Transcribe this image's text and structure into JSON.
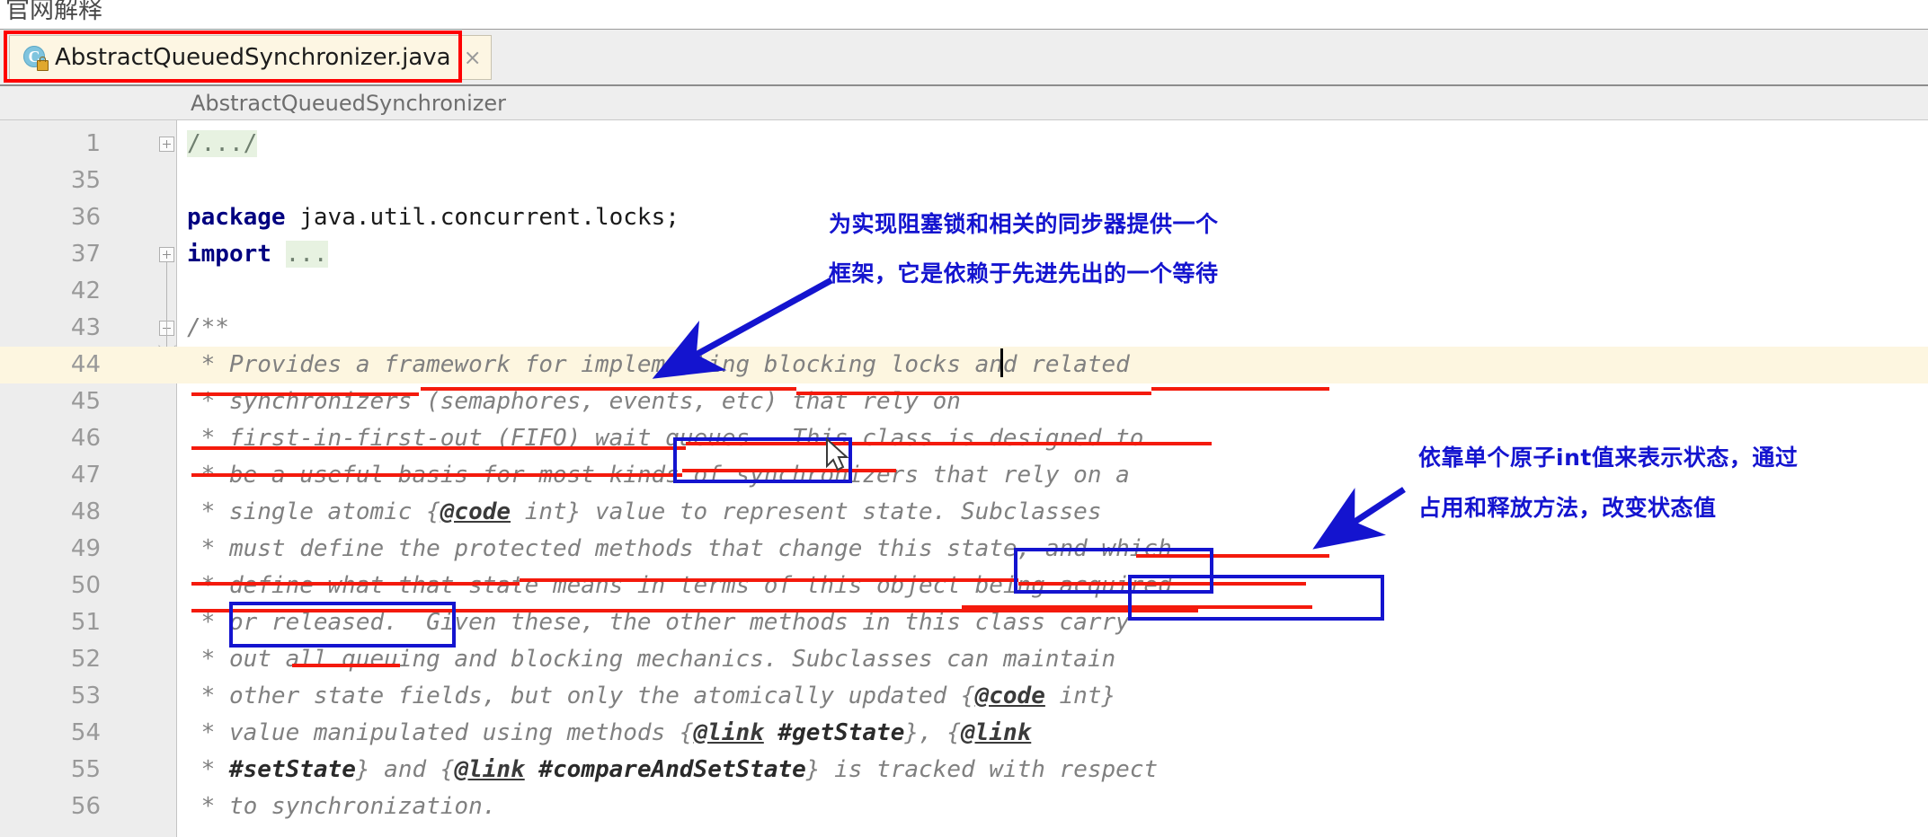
{
  "page": {
    "heading": "官网解释"
  },
  "tab": {
    "label": "AbstractQueuedSynchronizer.java",
    "close": "×",
    "icon_letter": "C",
    "icon_name": "java-class-locked-icon",
    "highlight_color": "#ff0000"
  },
  "breadcrumb": {
    "text": "AbstractQueuedSynchronizer"
  },
  "editor": {
    "current_line": 44,
    "lines": [
      {
        "no": "1",
        "segments": [
          {
            "t": "/.../",
            "c": "fold-ph"
          }
        ],
        "fold": "plus"
      },
      {
        "no": "35",
        "segments": [
          {
            "t": "",
            "c": "plain"
          }
        ]
      },
      {
        "no": "36",
        "segments": [
          {
            "t": "package ",
            "c": "kw"
          },
          {
            "t": "java.util.concurrent.locks;",
            "c": "plain"
          }
        ]
      },
      {
        "no": "37",
        "segments": [
          {
            "t": "import ",
            "c": "kw"
          },
          {
            "t": "...",
            "c": "fold-ph"
          }
        ],
        "fold": "plus"
      },
      {
        "no": "42",
        "segments": [
          {
            "t": "",
            "c": "plain"
          }
        ]
      },
      {
        "no": "43",
        "segments": [
          {
            "t": "/**",
            "c": "jdoc"
          }
        ],
        "fold": "minus"
      },
      {
        "no": "44",
        "segments": [
          {
            "t": " * Provides a framework for implementing blocking locks and related",
            "c": "jdoc"
          }
        ]
      },
      {
        "no": "45",
        "segments": [
          {
            "t": " * synchronizers (semaphores, events, etc) that rely on",
            "c": "jdoc"
          }
        ]
      },
      {
        "no": "46",
        "segments": [
          {
            "t": " * first-in-first-out (FIFO) wait queues.  This class is designed to",
            "c": "jdoc"
          }
        ]
      },
      {
        "no": "47",
        "segments": [
          {
            "t": " * be a useful basis for most kinds of synchronizers that rely on a",
            "c": "jdoc"
          }
        ]
      },
      {
        "no": "48",
        "segments": [
          {
            "t": " * single atomic {",
            "c": "jdoc"
          },
          {
            "t": "@code",
            "c": "tag"
          },
          {
            "t": " int} value to represent state. Subclasses",
            "c": "jdoc"
          }
        ]
      },
      {
        "no": "49",
        "segments": [
          {
            "t": " * must define the protected methods that change this state, and which",
            "c": "jdoc"
          }
        ]
      },
      {
        "no": "50",
        "segments": [
          {
            "t": " * define what that state means in terms of this object being acquired",
            "c": "jdoc"
          }
        ]
      },
      {
        "no": "51",
        "segments": [
          {
            "t": " * or released.  Given these, the other methods in this class carry",
            "c": "jdoc"
          }
        ]
      },
      {
        "no": "52",
        "segments": [
          {
            "t": " * out all queuing and blocking mechanics. Subclasses can maintain",
            "c": "jdoc"
          }
        ]
      },
      {
        "no": "53",
        "segments": [
          {
            "t": " * other state fields, but only the atomically updated {",
            "c": "jdoc"
          },
          {
            "t": "@code",
            "c": "tag"
          },
          {
            "t": " int}",
            "c": "jdoc"
          }
        ]
      },
      {
        "no": "54",
        "segments": [
          {
            "t": " * value manipulated using methods {",
            "c": "jdoc"
          },
          {
            "t": "@link",
            "c": "tag"
          },
          {
            "t": " ",
            "c": "jdoc"
          },
          {
            "t": "#getState",
            "c": "taglink"
          },
          {
            "t": "}, {",
            "c": "jdoc"
          },
          {
            "t": "@link",
            "c": "tag"
          }
        ]
      },
      {
        "no": "55",
        "segments": [
          {
            "t": " * ",
            "c": "jdoc"
          },
          {
            "t": "#setState",
            "c": "taglink"
          },
          {
            "t": "} and {",
            "c": "jdoc"
          },
          {
            "t": "@link",
            "c": "tag"
          },
          {
            "t": " ",
            "c": "jdoc"
          },
          {
            "t": "#compareAndSetState",
            "c": "taglink"
          },
          {
            "t": "} is tracked with respect",
            "c": "jdoc"
          }
        ]
      },
      {
        "no": "56",
        "segments": [
          {
            "t": " * to synchronization.",
            "c": "jdoc"
          }
        ]
      }
    ]
  },
  "annotations": {
    "color": "#1414cf",
    "underline_color": "#f41a0c",
    "note1": {
      "line1": "为实现阻塞锁和相关的同步器提供一个",
      "line2": "框架，它是依赖于先进先出的一个等待"
    },
    "note2": {
      "line1": "依靠单个原子int值来表示状态，通过",
      "line2": "占用和释放方法，改变状态值"
    },
    "boxed_phrases": [
      "wait queues.",
      "this state,",
      "being acquired",
      "or released."
    ]
  }
}
